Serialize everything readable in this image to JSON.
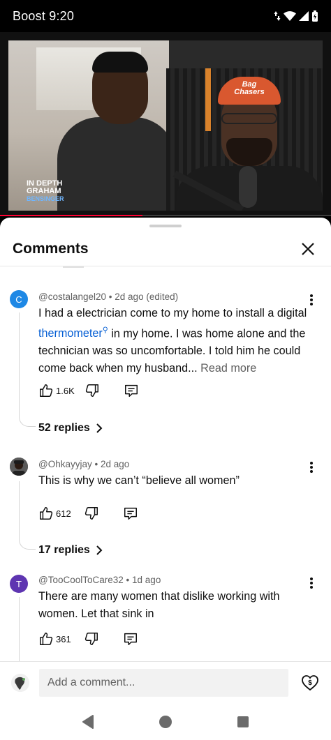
{
  "status_bar": {
    "carrier": "Boost",
    "time": "9:20"
  },
  "video": {
    "watermark_line1": "IN DEPTH",
    "watermark_line2": "GRAHAM",
    "watermark_line3": "BENSINGER",
    "cap_text": "Bag Chasers",
    "progress_fraction": 0.43
  },
  "comments_panel": {
    "title": "Comments",
    "comments": [
      {
        "avatar_letter": "C",
        "avatar_color": "#1e88e5",
        "author": "@costalangel20",
        "age": "2d ago (edited)",
        "text_before_link": "I had a electrician come to my home to install a digital ",
        "link_text": "thermometer",
        "text_after_link": " in my home. I was home alone and the technician was so uncomfortable. I told him he could come back when my husband...",
        "read_more": "Read more",
        "likes": "1.6K",
        "replies": "52 replies"
      },
      {
        "avatar_letter": "",
        "avatar_color": "#444444",
        "author": "@Ohkayyjay",
        "age": "2d ago",
        "text": "This is why we can’t “believe all women”",
        "likes": "612",
        "replies": "17 replies"
      },
      {
        "avatar_letter": "T",
        "avatar_color": "#5e35b1",
        "author": "@TooCoolToCare32",
        "age": "1d ago",
        "text": "There are many women that dislike working with women. Let that sink in",
        "likes": "361"
      }
    ],
    "add_comment_placeholder": "Add a comment..."
  },
  "icons": {
    "like": "thumbs-up-icon",
    "dislike": "thumbs-down-icon",
    "reply": "reply-comment-icon",
    "more": "more-vertical-icon",
    "close": "close-icon",
    "super_thanks": "super-thanks-icon"
  },
  "colors": {
    "accent_red": "#ff0033",
    "link_blue": "#065fd4"
  }
}
